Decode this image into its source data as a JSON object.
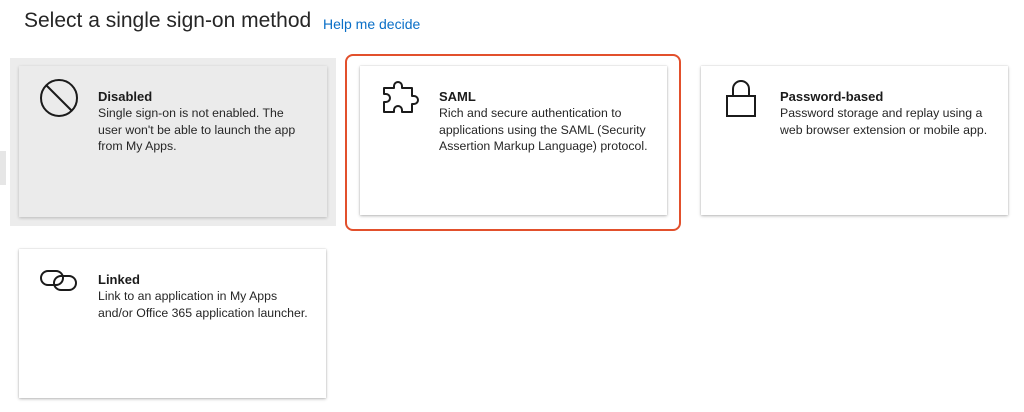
{
  "header": {
    "title": "Select a single sign-on method",
    "help_link": "Help me decide"
  },
  "methods": [
    {
      "title": "Disabled",
      "description": "Single sign-on is not enabled. The user won't be able to launch the app from My Apps.",
      "icon": "disabled-icon",
      "selected": true
    },
    {
      "title": "SAML",
      "description": "Rich and secure authentication to applications using the SAML (Security Assertion Markup Language) protocol.",
      "icon": "puzzle-piece-icon",
      "highlighted": true
    },
    {
      "title": "Password-based",
      "description": "Password storage and replay using a web browser extension or mobile app.",
      "icon": "lock-icon"
    },
    {
      "title": "Linked",
      "description": "Link to an application in My Apps and/or Office 365 application launcher.",
      "icon": "link-icon"
    }
  ],
  "colors": {
    "link": "#0a6fc7",
    "highlight_border": "#e2502c",
    "selected_background": "#ececec"
  }
}
